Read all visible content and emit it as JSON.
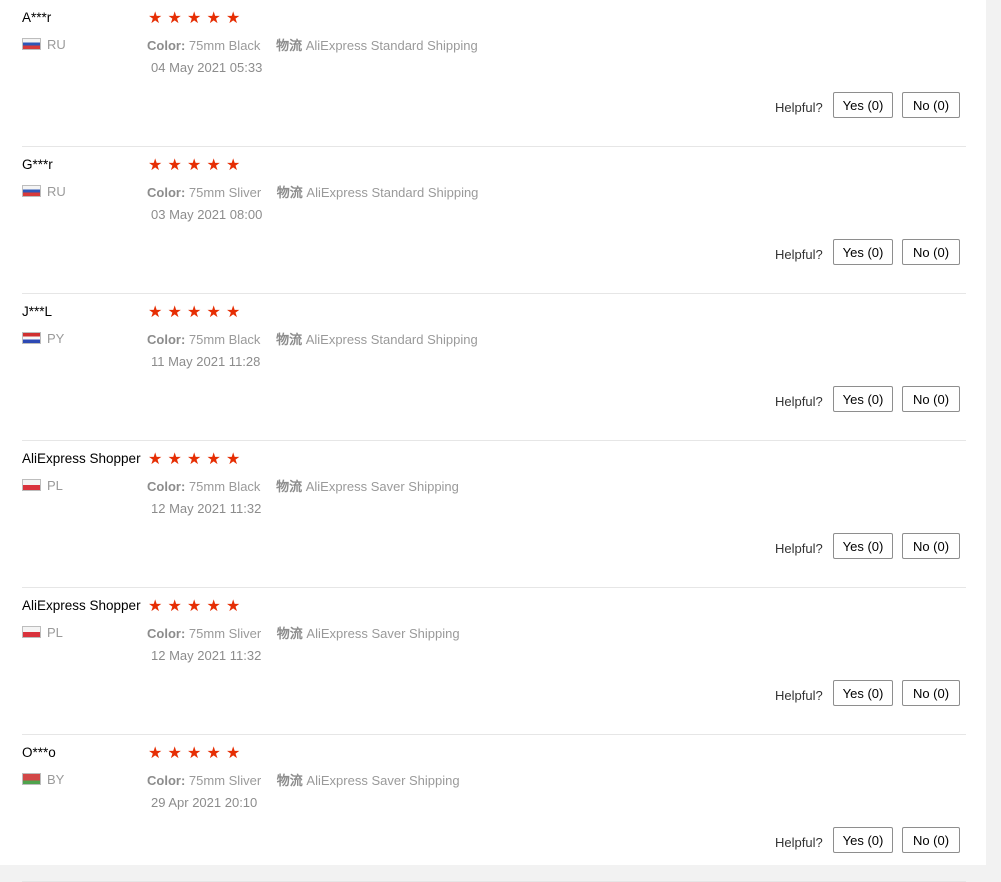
{
  "helpful_label": "Helpful?",
  "star_glyph": "★",
  "star_color": "#e62e04",
  "color_label": "Color:",
  "shipping_label": "物流",
  "reviews": [
    {
      "name": "A***r",
      "country": "RU",
      "rating": 5,
      "color": "75mm Black",
      "shipping": "AliExpress Standard Shipping",
      "date": "04 May 2021 05:33",
      "yes": "Yes (0)",
      "no": "No (0)"
    },
    {
      "name": "G***r",
      "country": "RU",
      "rating": 5,
      "color": "75mm Sliver",
      "shipping": "AliExpress Standard Shipping",
      "date": "03 May 2021 08:00",
      "yes": "Yes (0)",
      "no": "No (0)"
    },
    {
      "name": "J***L",
      "country": "PY",
      "rating": 5,
      "color": "75mm Black",
      "shipping": "AliExpress Standard Shipping",
      "date": "11 May 2021 11:28",
      "yes": "Yes (0)",
      "no": "No (0)"
    },
    {
      "name": "AliExpress Shopper",
      "country": "PL",
      "rating": 5,
      "color": "75mm Black",
      "shipping": "AliExpress Saver Shipping",
      "date": "12 May 2021 11:32",
      "yes": "Yes (0)",
      "no": "No (0)"
    },
    {
      "name": "AliExpress Shopper",
      "country": "PL",
      "rating": 5,
      "color": "75mm Sliver",
      "shipping": "AliExpress Saver Shipping",
      "date": "12 May 2021 11:32",
      "yes": "Yes (0)",
      "no": "No (0)"
    },
    {
      "name": "O***o",
      "country": "BY",
      "rating": 5,
      "color": "75mm Sliver",
      "shipping": "AliExpress Saver Shipping",
      "date": "29 Apr 2021 20:10",
      "yes": "Yes (0)",
      "no": "No (0)"
    }
  ]
}
